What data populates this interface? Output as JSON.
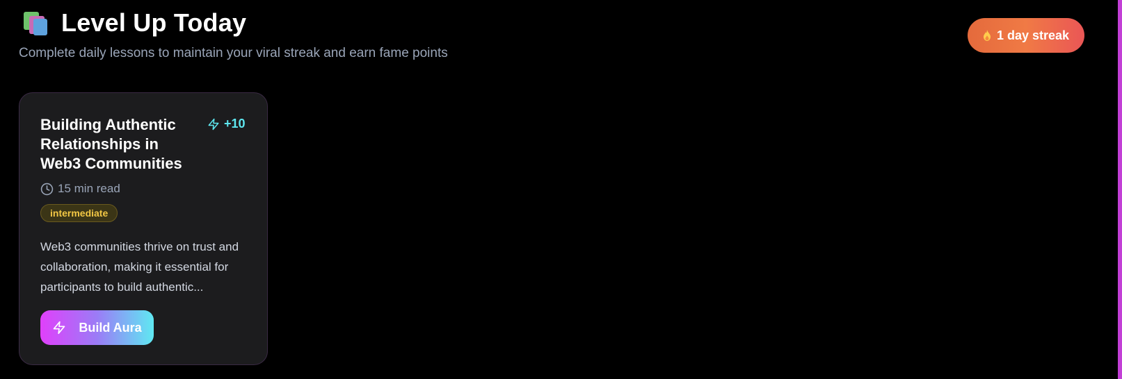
{
  "header": {
    "icon": "books-icon",
    "title": "Level Up Today",
    "subtitle": "Complete daily lessons to maintain your viral streak and earn fame points"
  },
  "streak": {
    "icon": "flame-icon",
    "label": "1 day streak"
  },
  "lesson_card": {
    "title": "Building Authentic Relationships in Web3 Communities",
    "points_icon": "lightning-icon",
    "points": "+10",
    "read_icon": "clock-icon",
    "read_time": "15 min read",
    "level": "intermediate",
    "description": "Web3 communities thrive on trust and collaboration, making it essential for participants to build authentic...",
    "action_icon": "lightning-icon",
    "action_label": "Build Aura"
  },
  "colors": {
    "background": "#000000",
    "accent_cyan": "#5ee7f0",
    "accent_magenta": "#e040fb",
    "streak_orange": "#f07a45",
    "badge_yellow": "#f2c744"
  }
}
